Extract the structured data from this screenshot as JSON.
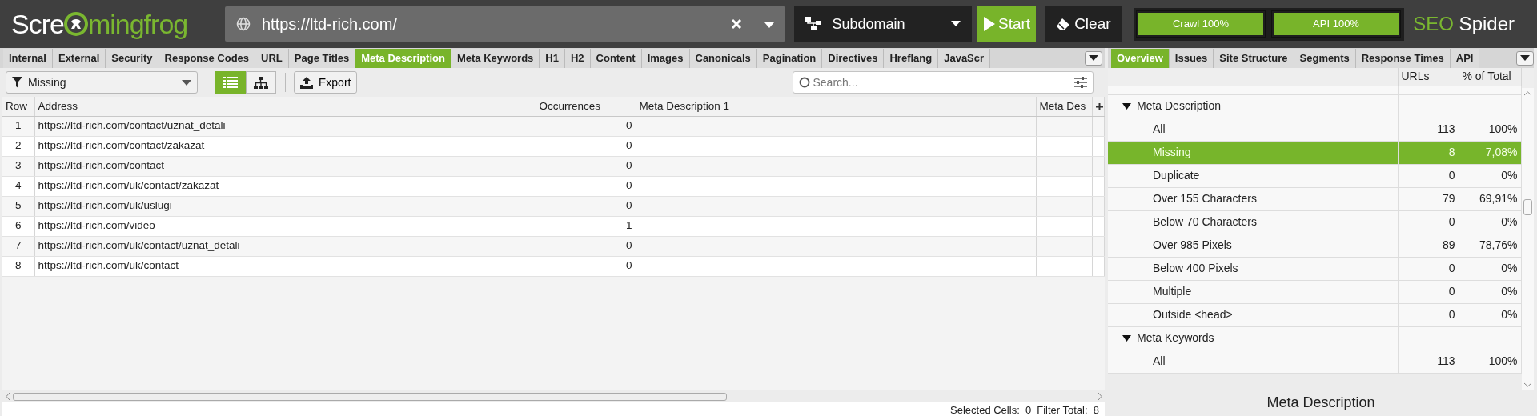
{
  "logo": {
    "text_before": "Scre",
    "text_after": "mingfrog"
  },
  "url_field": {
    "value": "https://ltd-rich.com/"
  },
  "mode_dropdown": {
    "value": "Subdomain"
  },
  "buttons": [
    {
      "label": "Start",
      "kind": "start"
    },
    {
      "label": "Clear",
      "kind": "clear"
    }
  ],
  "progress": [
    {
      "label": "Crawl 100%",
      "level": 1
    },
    {
      "label": "API 100%",
      "level": 1
    }
  ],
  "product": {
    "brand": "SEO",
    "name": "Spider"
  },
  "left_tabs": [
    {
      "label": "Internal",
      "selected": false
    },
    {
      "label": "External",
      "selected": false
    },
    {
      "label": "Security",
      "selected": false
    },
    {
      "label": "Response Codes",
      "selected": false
    },
    {
      "label": "URL",
      "selected": false
    },
    {
      "label": "Page Titles",
      "selected": false
    },
    {
      "label": "Meta Description",
      "selected": true
    },
    {
      "label": "Meta Keywords",
      "selected": false
    },
    {
      "label": "H1",
      "selected": false
    },
    {
      "label": "H2",
      "selected": false
    },
    {
      "label": "Content",
      "selected": false
    },
    {
      "label": "Images",
      "selected": false
    },
    {
      "label": "Canonicals",
      "selected": false
    },
    {
      "label": "Pagination",
      "selected": false
    },
    {
      "label": "Directives",
      "selected": false
    },
    {
      "label": "Hreflang",
      "selected": false
    },
    {
      "label": "JavaScr",
      "selected": false
    }
  ],
  "filter": {
    "value": "Missing"
  },
  "view_toggle": [
    {
      "kind": "list",
      "selected": true
    },
    {
      "kind": "tree",
      "selected": false
    }
  ],
  "export_button": "Export",
  "search": {
    "placeholder": "Search..."
  },
  "table": {
    "columns": [
      "Row",
      "Address",
      "Occurrences",
      "Meta Description 1",
      "Meta Des"
    ],
    "rows": [
      [
        "1",
        "https://ltd-rich.com/contact/uznat_detali",
        "0",
        "",
        ""
      ],
      [
        "2",
        "https://ltd-rich.com/contact/zakazat",
        "0",
        "",
        ""
      ],
      [
        "3",
        "https://ltd-rich.com/contact",
        "0",
        "",
        ""
      ],
      [
        "4",
        "https://ltd-rich.com/uk/contact/zakazat",
        "0",
        "",
        ""
      ],
      [
        "5",
        "https://ltd-rich.com/uk/uslugi",
        "0",
        "",
        ""
      ],
      [
        "6",
        "https://ltd-rich.com/video",
        "1",
        "",
        ""
      ],
      [
        "7",
        "https://ltd-rich.com/uk/contact/uznat_detali",
        "0",
        "",
        ""
      ],
      [
        "8",
        "https://ltd-rich.com/uk/contact",
        "0",
        "",
        ""
      ]
    ]
  },
  "status_bar": {
    "selected_cells": "Selected Cells:  0",
    "filter_total": "Filter Total:  8"
  },
  "right_tabs": [
    {
      "label": "Overview",
      "selected": true
    },
    {
      "label": "Issues",
      "selected": false
    },
    {
      "label": "Site Structure",
      "selected": false
    },
    {
      "label": "Segments",
      "selected": false
    },
    {
      "label": "Response Times",
      "selected": false
    },
    {
      "label": "API",
      "selected": false
    }
  ],
  "overview": {
    "columns": [
      "URLs",
      "% of Total"
    ],
    "groups": [
      {
        "label": "Meta Description",
        "expanded": true,
        "children": [
          {
            "label": "All",
            "urls": "113",
            "percent": "100%",
            "selected": false
          },
          {
            "label": "Missing",
            "urls": "8",
            "percent": "7,08%",
            "selected": true
          },
          {
            "label": "Duplicate",
            "urls": "0",
            "percent": "0%",
            "selected": false
          },
          {
            "label": "Over 155 Characters",
            "urls": "79",
            "percent": "69,91%",
            "selected": false
          },
          {
            "label": "Below 70 Characters",
            "urls": "0",
            "percent": "0%",
            "selected": false
          },
          {
            "label": "Over 985 Pixels",
            "urls": "89",
            "percent": "78,76%",
            "selected": false
          },
          {
            "label": "Below 400 Pixels",
            "urls": "0",
            "percent": "0%",
            "selected": false
          },
          {
            "label": "Multiple",
            "urls": "0",
            "percent": "0%",
            "selected": false
          },
          {
            "label": "Outside <head>",
            "urls": "0",
            "percent": "0%",
            "selected": false
          }
        ]
      },
      {
        "label": "Meta Keywords",
        "expanded": true,
        "children": [
          {
            "label": "All",
            "urls": "113",
            "percent": "100%",
            "selected": false
          }
        ]
      }
    ]
  },
  "details_title": "Meta Description"
}
